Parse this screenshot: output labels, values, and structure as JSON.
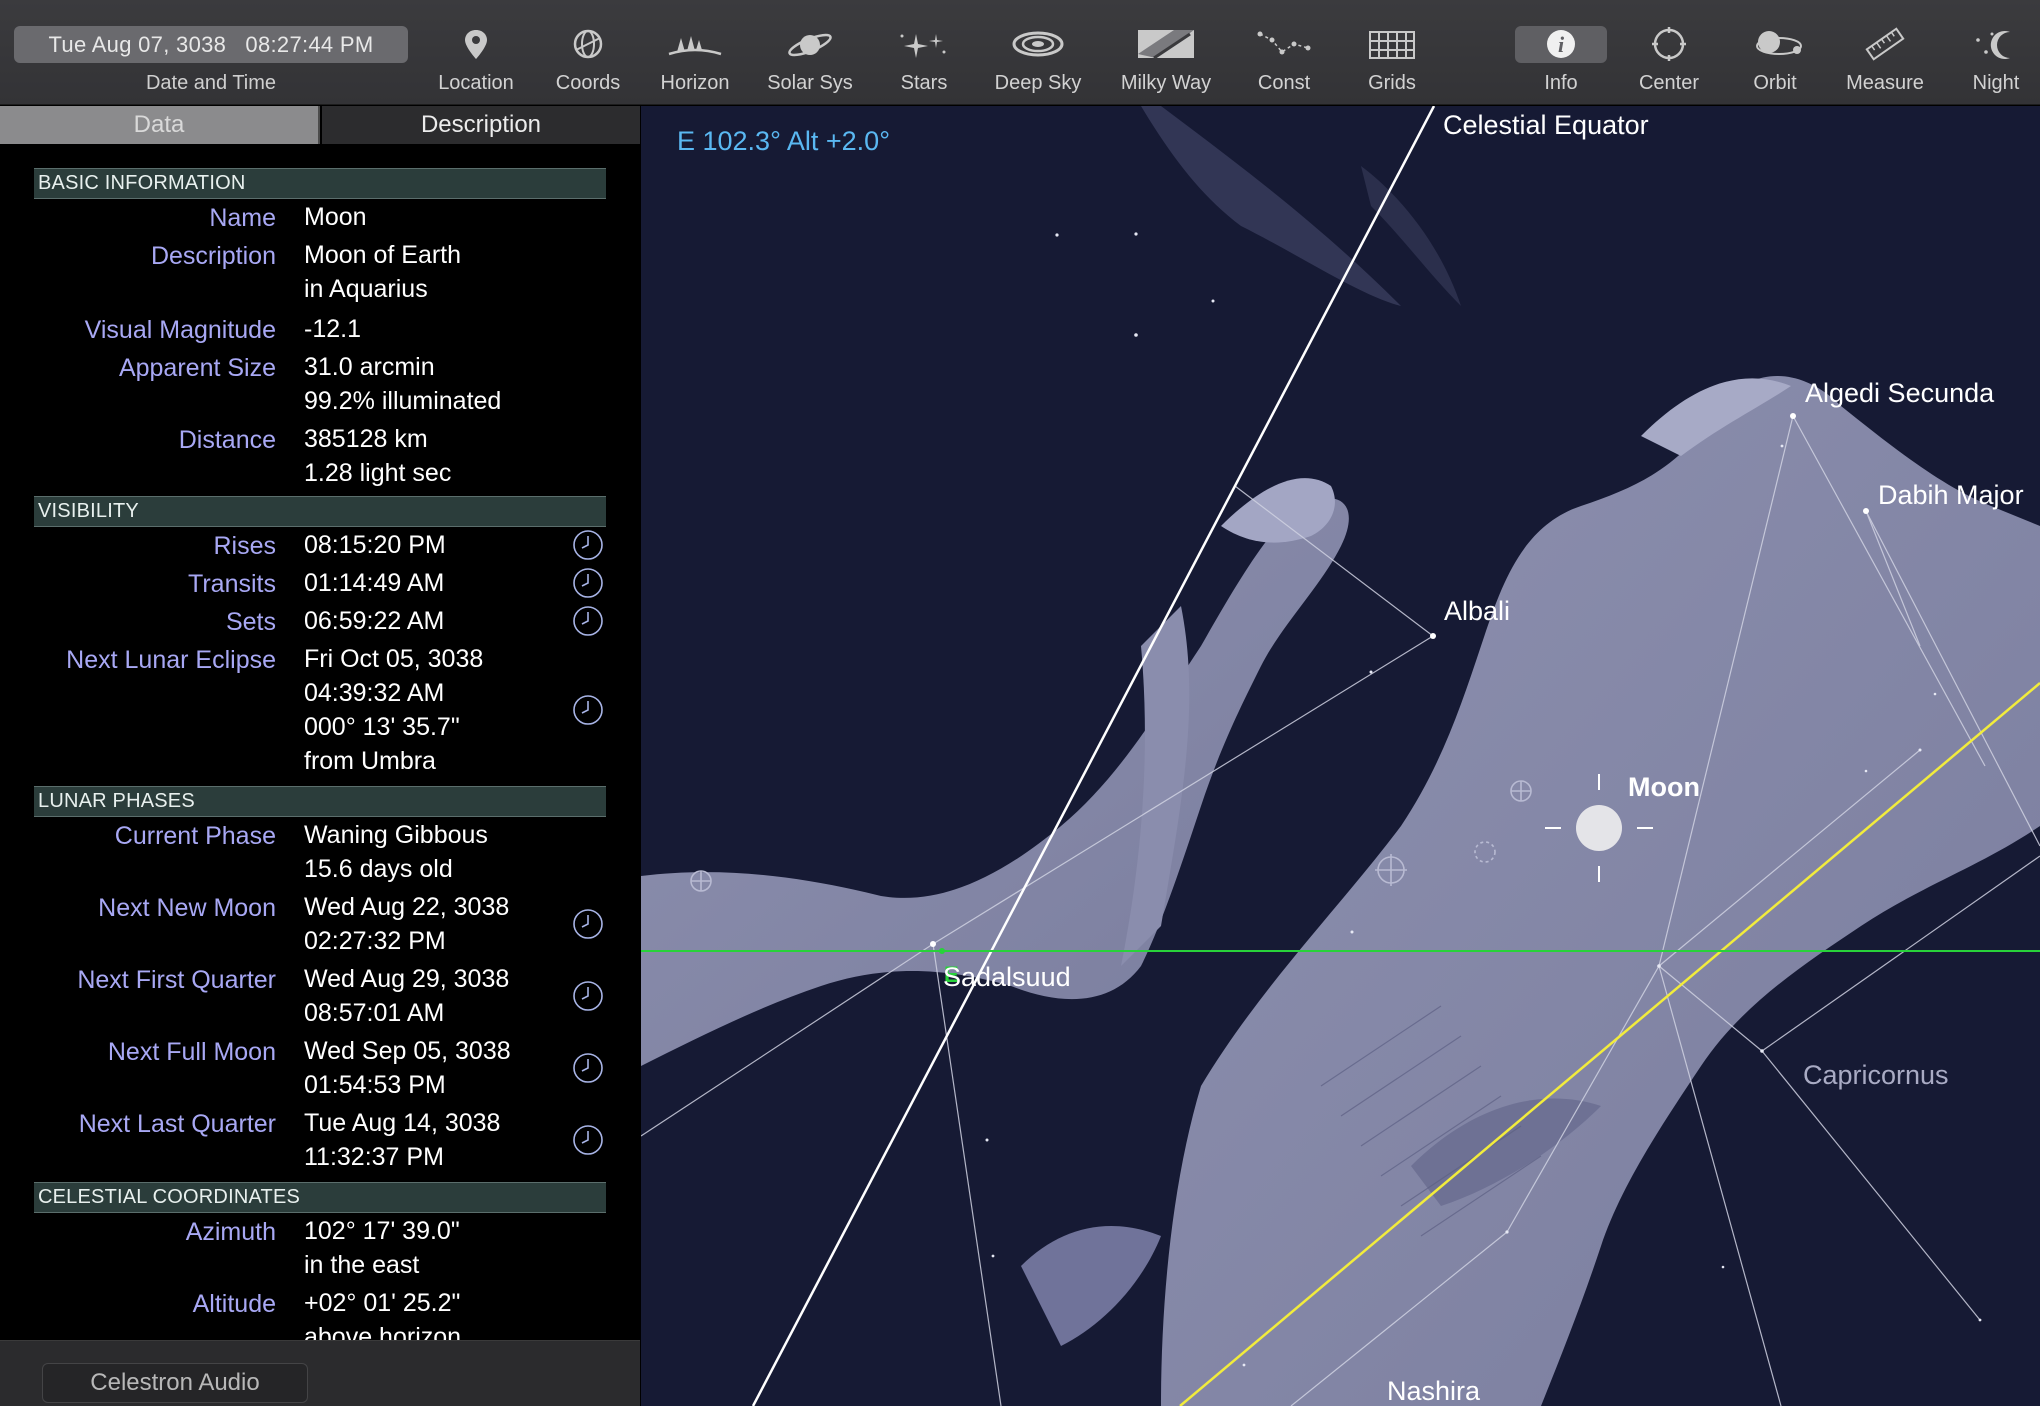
{
  "toolbar": {
    "datetime": "Tue Aug 07, 3038   08:27:44 PM",
    "datetime_label": "Date and Time",
    "tools": [
      {
        "label": "Location",
        "icon": "location-pin-icon"
      },
      {
        "label": "Coords",
        "icon": "coords-icon"
      },
      {
        "label": "Horizon",
        "icon": "horizon-icon"
      },
      {
        "label": "Solar Sys",
        "icon": "planet-icon"
      },
      {
        "label": "Stars",
        "icon": "stars-icon"
      },
      {
        "label": "Deep Sky",
        "icon": "galaxy-icon"
      },
      {
        "label": "Milky Way",
        "icon": "milky-way-icon"
      },
      {
        "label": "Const",
        "icon": "constellation-icon"
      },
      {
        "label": "Grids",
        "icon": "grid-icon"
      },
      {
        "label": "Info",
        "icon": "info-icon",
        "active": true
      },
      {
        "label": "Center",
        "icon": "center-icon"
      },
      {
        "label": "Orbit",
        "icon": "orbit-icon"
      },
      {
        "label": "Measure",
        "icon": "ruler-icon"
      },
      {
        "label": "Night",
        "icon": "moon-stars-icon"
      }
    ]
  },
  "panel": {
    "tabs": {
      "data": "Data",
      "description": "Description"
    },
    "sections": {
      "basic": "BASIC INFORMATION",
      "visibility": "VISIBILITY",
      "lunar": "LUNAR PHASES",
      "coords": "CELESTIAL COORDINATES"
    },
    "basic": {
      "name_k": "Name",
      "name_v": "Moon",
      "desc_k": "Description",
      "desc_v1": "Moon of Earth",
      "desc_v2": "in Aquarius",
      "mag_k": "Visual Magnitude",
      "mag_v": "-12.1",
      "size_k": "Apparent Size",
      "size_v1": "31.0 arcmin",
      "size_v2": "99.2% illuminated",
      "dist_k": "Distance",
      "dist_v1": "385128 km",
      "dist_v2": "1.28 light sec"
    },
    "visibility": {
      "rises_k": "Rises",
      "rises_v": "08:15:20 PM",
      "transits_k": "Transits",
      "transits_v": "01:14:49 AM",
      "sets_k": "Sets",
      "sets_v": "06:59:22 AM",
      "eclipse_k": "Next Lunar Eclipse",
      "eclipse_v1": "Fri Oct 05, 3038",
      "eclipse_v2": "04:39:32 AM",
      "eclipse_v3": "000° 13' 35.7\"",
      "eclipse_v4": "from Umbra"
    },
    "lunar": {
      "phase_k": "Current Phase",
      "phase_v1": "Waning Gibbous",
      "phase_v2": "15.6 days old",
      "new_k": "Next New Moon",
      "new_v1": "Wed Aug 22, 3038",
      "new_v2": "02:27:32 PM",
      "first_k": "Next First Quarter",
      "first_v1": "Wed Aug 29, 3038",
      "first_v2": "08:57:01 AM",
      "full_k": "Next Full Moon",
      "full_v1": "Wed Sep 05, 3038",
      "full_v2": "01:54:53 PM",
      "last_k": "Next Last Quarter",
      "last_v1": "Tue Aug 14, 3038",
      "last_v2": "11:32:37 PM"
    },
    "coords": {
      "az_k": "Azimuth",
      "az_v1": "102° 17' 39.0\"",
      "az_v2": "in the east",
      "alt_k": "Altitude",
      "alt_v1": "+02° 01' 25.2\"",
      "alt_v2": "above horizon"
    }
  },
  "status": {
    "audio": "Celestron Audio"
  },
  "sky": {
    "readout": "E 102.3° Alt +2.0°",
    "labels": {
      "celestial_equator": "Celestial Equator",
      "algedi_secunda": "Algedi Secunda",
      "dabih_major": "Dabih Major",
      "albali": "Albali",
      "moon": "Moon",
      "sadalsuud": "Sadalsuud",
      "capricornus": "Capricornus",
      "nashira": "Nashira",
      "horizon_marker": "E"
    },
    "colors": {
      "background": "#161a34",
      "artwork": "#8d90b0",
      "equator": "#ffffff",
      "ecliptic": "#f2ec3c",
      "horizon": "#28d23a",
      "readout": "#5ab8f2"
    }
  }
}
